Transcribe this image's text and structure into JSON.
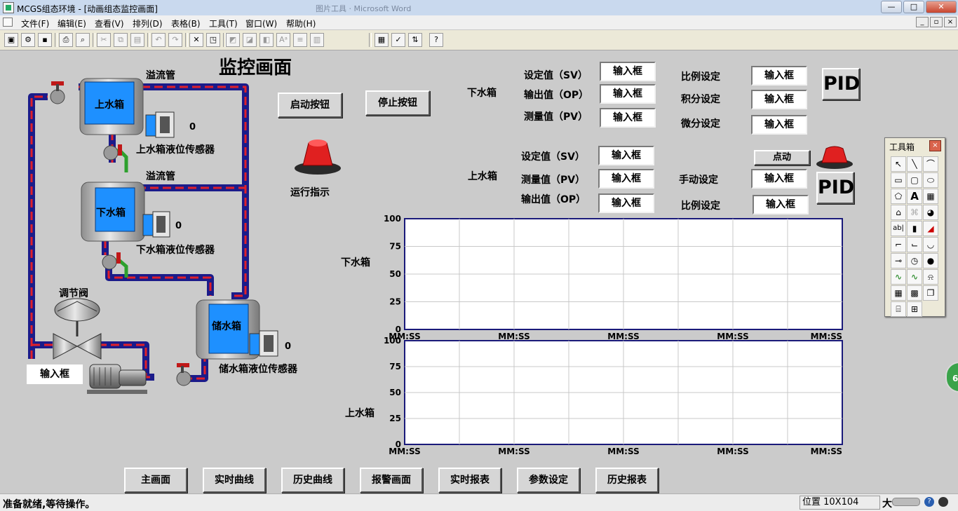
{
  "window": {
    "title": "MCGS组态环境 - [动画组态监控画面]",
    "background_ghost_title": "图片工具 · Microsoft Word"
  },
  "menu": {
    "items": [
      "文件(F)",
      "编辑(E)",
      "查看(V)",
      "排列(D)",
      "表格(B)",
      "工具(T)",
      "窗口(W)",
      "帮助(H)"
    ]
  },
  "page": {
    "title": "监控画面",
    "start_button": "启动按钮",
    "stop_button": "停止按钮",
    "run_indicator_label": "运行指示"
  },
  "process": {
    "overflow_pipe_top": "溢流管",
    "overflow_pipe_mid": "溢流管",
    "upper_tank": "上水箱",
    "lower_tank": "下水箱",
    "storage_tank": "储水箱",
    "upper_sensor": "上水箱液位传感器",
    "lower_sensor": "下水箱液位传感器",
    "storage_sensor": "储水箱液位传感器",
    "upper_sensor_value": "0",
    "lower_sensor_value": "0",
    "storage_sensor_value": "0",
    "valve_label": "调节阀",
    "valve_input": "输入框"
  },
  "lower_tank_panel": {
    "group_label": "下水箱",
    "sv_label": "设定值（SV）",
    "op_label": "输出值（OP）",
    "pv_label": "测量值（PV）",
    "sv_value": "输入框",
    "op_value": "输入框",
    "pv_value": "输入框",
    "p_label": "比例设定",
    "i_label": "积分设定",
    "d_label": "微分设定",
    "p_value": "输入框",
    "i_value": "输入框",
    "d_value": "输入框",
    "pid_button": "PID"
  },
  "upper_tank_panel": {
    "group_label": "上水箱",
    "sv_label": "设定值（SV）",
    "pv_label": "测量值（PV）",
    "op_label": "输出值（OP）",
    "sv_value": "输入框",
    "pv_value": "输入框",
    "op_value": "输入框",
    "jog_button": "点动",
    "manual_label": "手动设定",
    "manual_value": "输入框",
    "p_label": "比例设定",
    "p_value": "输入框",
    "pid_button": "PID"
  },
  "nav_buttons": [
    "主画面",
    "实时曲线",
    "历史曲线",
    "报警画面",
    "实时报表",
    "参数设定",
    "历史报表"
  ],
  "toolbox": {
    "title": "工具箱",
    "close": "×",
    "text_tool": "A",
    "label_tool": "ab|"
  },
  "status": {
    "message": "准备就绪,等待操作。",
    "position": "位置 10X104",
    "size_label": "大",
    "help_glyph": "?"
  },
  "side_badge": "66",
  "colors": {
    "tank_water": "#1e90ff",
    "pipe_outer": "#1b1b8a",
    "pipe_inner": "#e0202a",
    "chart_border": "#1a1a7a",
    "indicator_red": "#e02020"
  },
  "chart_data": [
    {
      "type": "line",
      "title": "",
      "ylabel": "下水箱",
      "ylim": [
        0,
        100
      ],
      "yticks": [
        "100",
        "75",
        "50",
        "25",
        "0"
      ],
      "xticks": [
        "MM:SS",
        "MM:SS",
        "MM:SS",
        "MM:SS",
        "MM:SS"
      ],
      "grid": true,
      "series": []
    },
    {
      "type": "line",
      "title": "",
      "ylabel": "上水箱",
      "ylim": [
        0,
        100
      ],
      "yticks": [
        "100",
        "75",
        "50",
        "25",
        "0"
      ],
      "xticks": [
        "MM:SS",
        "MM:SS",
        "MM:SS",
        "MM:SS",
        "MM:SS"
      ],
      "grid": true,
      "series": []
    }
  ]
}
